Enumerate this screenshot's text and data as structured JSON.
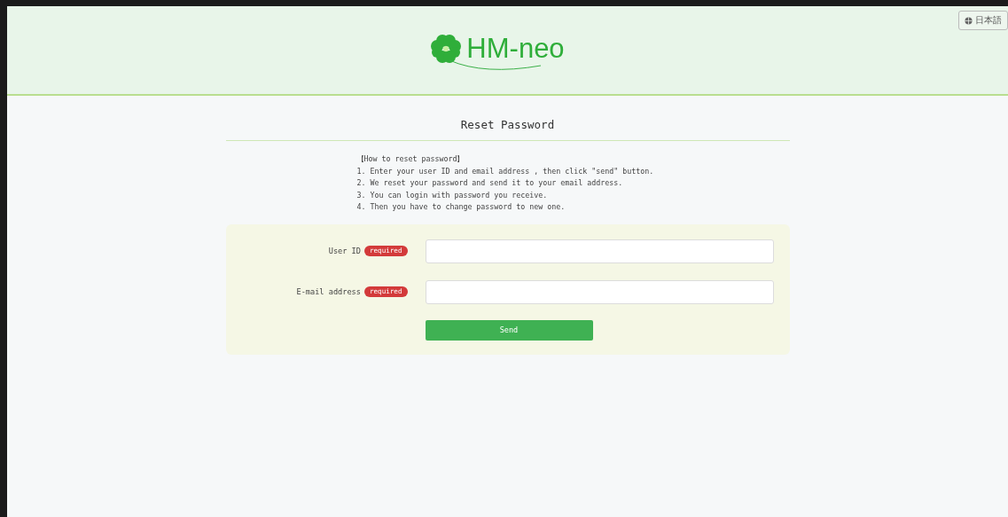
{
  "header": {
    "logo_text": "HM-neo",
    "language_button": "日本語"
  },
  "title": "Reset Password",
  "instructions": {
    "heading": "【How to reset password】",
    "steps": [
      "1. Enter your user ID and email address , then click \"send\" button.",
      "2. We reset your password and send it to your email address.",
      "3. You can login with password you receive.",
      "4. Then you have to change password to new one."
    ]
  },
  "form": {
    "fields": [
      {
        "label": "User ID",
        "badge": "required"
      },
      {
        "label": "E-mail address",
        "badge": "required"
      }
    ],
    "submit": "Send"
  }
}
